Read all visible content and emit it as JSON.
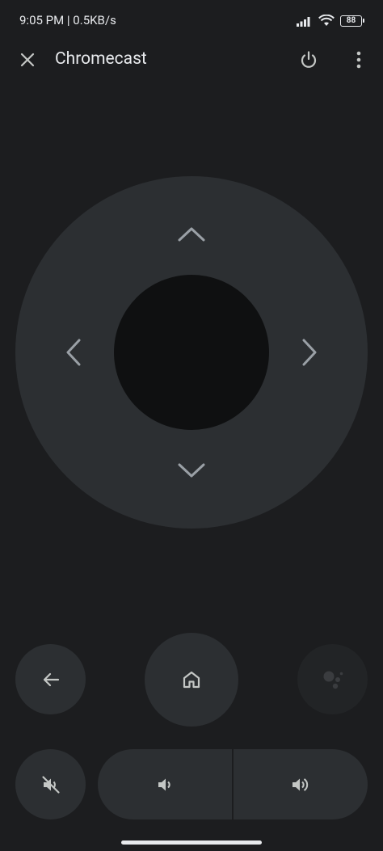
{
  "status_bar": {
    "left_text": "9:05 PM | 0.5KB/s",
    "battery_level": "88",
    "signal_icon": "signal-icon",
    "wifi_icon": "wifi-icon"
  },
  "app_bar": {
    "title": "Chromecast",
    "close_icon": "close-icon",
    "power_icon": "power-icon",
    "more_icon": "more-vert-icon"
  },
  "dpad": {
    "up_icon": "chevron-up-icon",
    "down_icon": "chevron-down-icon",
    "left_icon": "chevron-left-icon",
    "right_icon": "chevron-right-icon"
  },
  "buttons": {
    "back_icon": "arrow-back-icon",
    "home_icon": "home-icon",
    "assistant_icon": "assistant-icon",
    "mute_icon": "volume-off-icon",
    "volume_down_icon": "volume-down-icon",
    "volume_up_icon": "volume-up-icon"
  },
  "colors": {
    "background": "#1c1d1f",
    "surface": "#2c2f32",
    "dpad_center": "#0f1011",
    "icon": "#9aa0a6",
    "text": "#e8eaed"
  }
}
